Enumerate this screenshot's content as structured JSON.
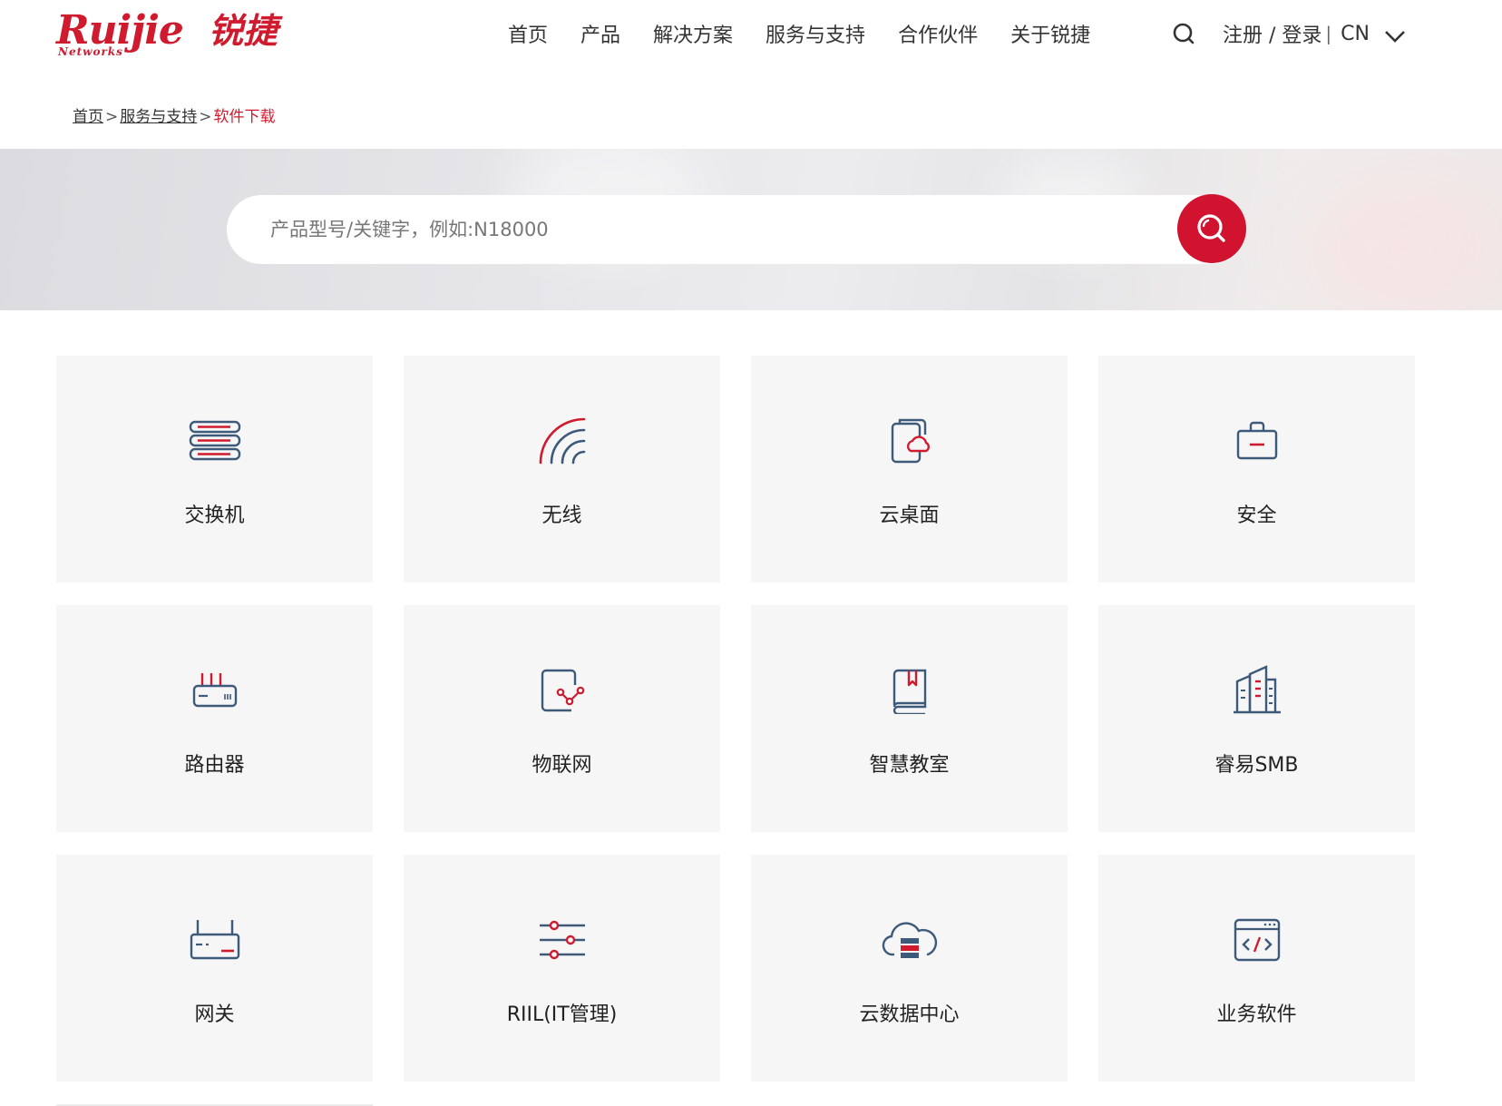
{
  "logo": {
    "brand": "Ruijie",
    "brand_cn": "锐捷",
    "sub": "Networks"
  },
  "nav": [
    "首页",
    "产品",
    "解决方案",
    "服务与支持",
    "合作伙伴",
    "关于锐捷"
  ],
  "header": {
    "login": "注册 / 登录",
    "separator": "|",
    "lang": "CN"
  },
  "breadcrumb": {
    "home": "首页",
    "gt": ">",
    "service": "服务与支持",
    "current": "软件下载"
  },
  "search": {
    "placeholder": "产品型号/关键字，例如:N18000"
  },
  "colors": {
    "brand_red": "#d01a2e",
    "icon_blue": "#3d5a7a",
    "card_bg": "#f6f6f6"
  },
  "categories": [
    {
      "label": "交换机",
      "icon": "switch-icon"
    },
    {
      "label": "无线",
      "icon": "wireless-icon"
    },
    {
      "label": "云桌面",
      "icon": "cloud-desktop-icon"
    },
    {
      "label": "安全",
      "icon": "security-icon"
    },
    {
      "label": "路由器",
      "icon": "router-icon"
    },
    {
      "label": "物联网",
      "icon": "iot-icon"
    },
    {
      "label": "智慧教室",
      "icon": "smart-classroom-icon"
    },
    {
      "label": "睿易SMB",
      "icon": "smb-building-icon"
    },
    {
      "label": "网关",
      "icon": "gateway-icon"
    },
    {
      "label": "RIIL(IT管理)",
      "icon": "sliders-icon"
    },
    {
      "label": "云数据中心",
      "icon": "cloud-datacenter-icon"
    },
    {
      "label": "业务软件",
      "icon": "code-window-icon"
    }
  ]
}
